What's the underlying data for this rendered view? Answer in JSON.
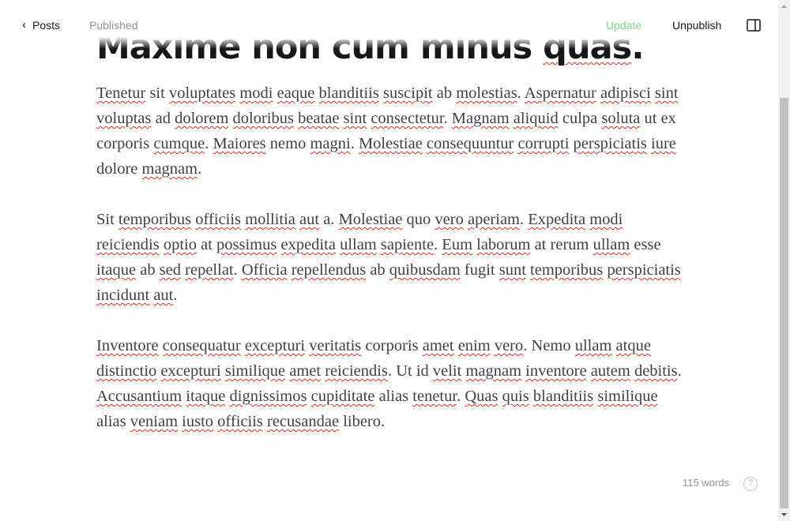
{
  "header": {
    "back_label": "Posts",
    "status": "Published",
    "update_label": "Update",
    "unpublish_label": "Unpublish"
  },
  "post": {
    "title_prefix": "Maxime non cum minus ",
    "title_misspelled": "quas",
    "title_suffix": ".",
    "paragraphs": [
      "Tenetur sit voluptates modi eaque blanditiis suscipit ab molestias. Aspernatur adipisci sint voluptas ad dolorem doloribus beatae sint consectetur. Magnam aliquid culpa soluta ut ex corporis cumque. Maiores nemo magni. Molestiae consequuntur corrupti perspiciatis iure dolore magnam.",
      "Sit temporibus officiis mollitia aut a. Molestiae quo vero aperiam. Expedita modi reiciendis optio at possimus expedita ullam sapiente. Eum laborum at rerum ullam esse itaque ab sed repellat. Officia repellendus ab quibusdam fugit sunt temporibus perspiciatis incidunt aut.",
      "Inventore consequatur excepturi veritatis corporis amet enim vero. Nemo ullam atque distinctio excepturi similique amet reiciendis. Ut id velit magnam inventore autem debitis. Accusantium itaque dignissimos cupiditate alias tenetur. Quas quis blanditiis similique alias veniam iusto officiis recusandae libero."
    ]
  },
  "footer": {
    "word_count": "115 words",
    "help_symbol": "?"
  },
  "icons": {
    "back": "chevron-left-icon",
    "sidebar": "sidebar-toggle-icon",
    "help": "help-circle-icon"
  },
  "colors": {
    "update": "#7dd38a",
    "spellcheck": "#d93025",
    "muted": "#8e9299"
  }
}
